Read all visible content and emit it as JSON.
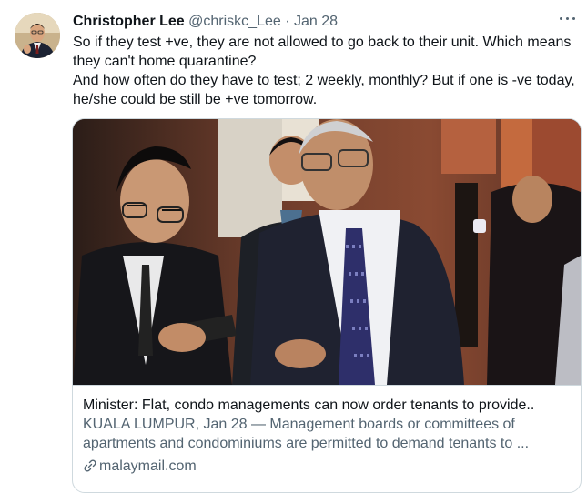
{
  "tweet": {
    "author_name": "Christopher Lee",
    "author_handle": "@chriskc_Lee",
    "separator": "·",
    "date": "Jan 28",
    "text_lines": [
      "So if they test +ve, they are not allowed to go back to their unit. Which means they can't home quarantine?",
      "And how often do they have to test; 2 weekly,  monthly? But if one is -ve today, he/she could be still be +ve tomorrow."
    ]
  },
  "card": {
    "title": "Minister: Flat, condo managements can now order tenants to provide..",
    "description": "KUALA LUMPUR, Jan 28 — Management boards or committees of apartments and condominiums are permitted to demand tenants to ...",
    "domain": "malaymail.com",
    "domain_icon": "link-icon"
  },
  "icons": {
    "more": "more-icon",
    "avatar": "avatar"
  },
  "colors": {
    "text_primary": "#0f1419",
    "text_secondary": "#536471",
    "border": "#cfd9de"
  }
}
